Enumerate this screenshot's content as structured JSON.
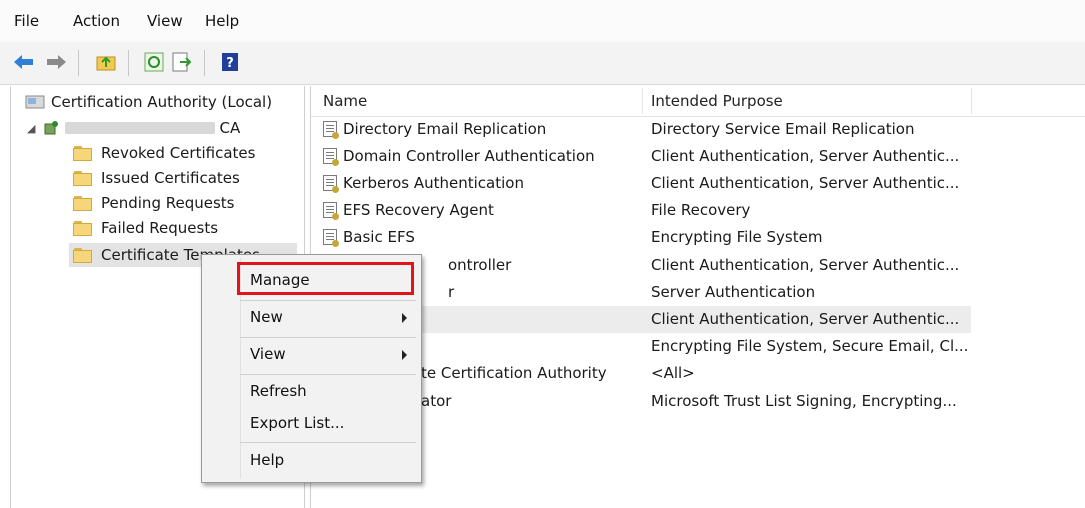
{
  "menubar": {
    "items": [
      "File",
      "Action",
      "View",
      "Help"
    ]
  },
  "toolbar": {
    "buttons": [
      "back-icon",
      "forward-icon",
      "up-folder-icon",
      "refresh-icon",
      "export-list-icon",
      "help-icon"
    ],
    "colors": {
      "arrow_blue": "#2f7fd6",
      "folder_yellow": "#f6d67a",
      "help_blue": "#1f3f9a"
    }
  },
  "tree": {
    "root_label": "Certification Authority (Local)",
    "ca_suffix": "CA",
    "items": [
      "Revoked Certificates",
      "Issued Certificates",
      "Pending Requests",
      "Failed Requests",
      "Certificate Templates"
    ]
  },
  "list": {
    "columns": [
      "Name",
      "Intended Purpose"
    ],
    "rows": [
      {
        "name": "Directory Email Replication",
        "purpose": "Directory Service Email Replication"
      },
      {
        "name": "Domain Controller Authentication",
        "purpose": "Client Authentication, Server Authentic..."
      },
      {
        "name": "Kerberos Authentication",
        "purpose": "Client Authentication, Server Authentic..."
      },
      {
        "name": "EFS Recovery Agent",
        "purpose": "File Recovery"
      },
      {
        "name": "Basic EFS",
        "purpose": "Encrypting File System"
      },
      {
        "name": "ontroller",
        "purpose": "Client Authentication, Server Authentic..."
      },
      {
        "name": "r",
        "purpose": "Server Authentication"
      },
      {
        "name": "",
        "purpose": "Client Authentication, Server Authentic..."
      },
      {
        "name": "",
        "purpose": "Encrypting File System, Secure Email, Cl..."
      },
      {
        "name": "te Certification Authority",
        "purpose": "<All>"
      },
      {
        "name": "ator",
        "purpose": "Microsoft Trust List Signing, Encrypting..."
      }
    ]
  },
  "context_menu": {
    "items": [
      "Manage",
      "New",
      "View",
      "Refresh",
      "Export List...",
      "Help"
    ],
    "highlight_color": "#e3131b"
  }
}
